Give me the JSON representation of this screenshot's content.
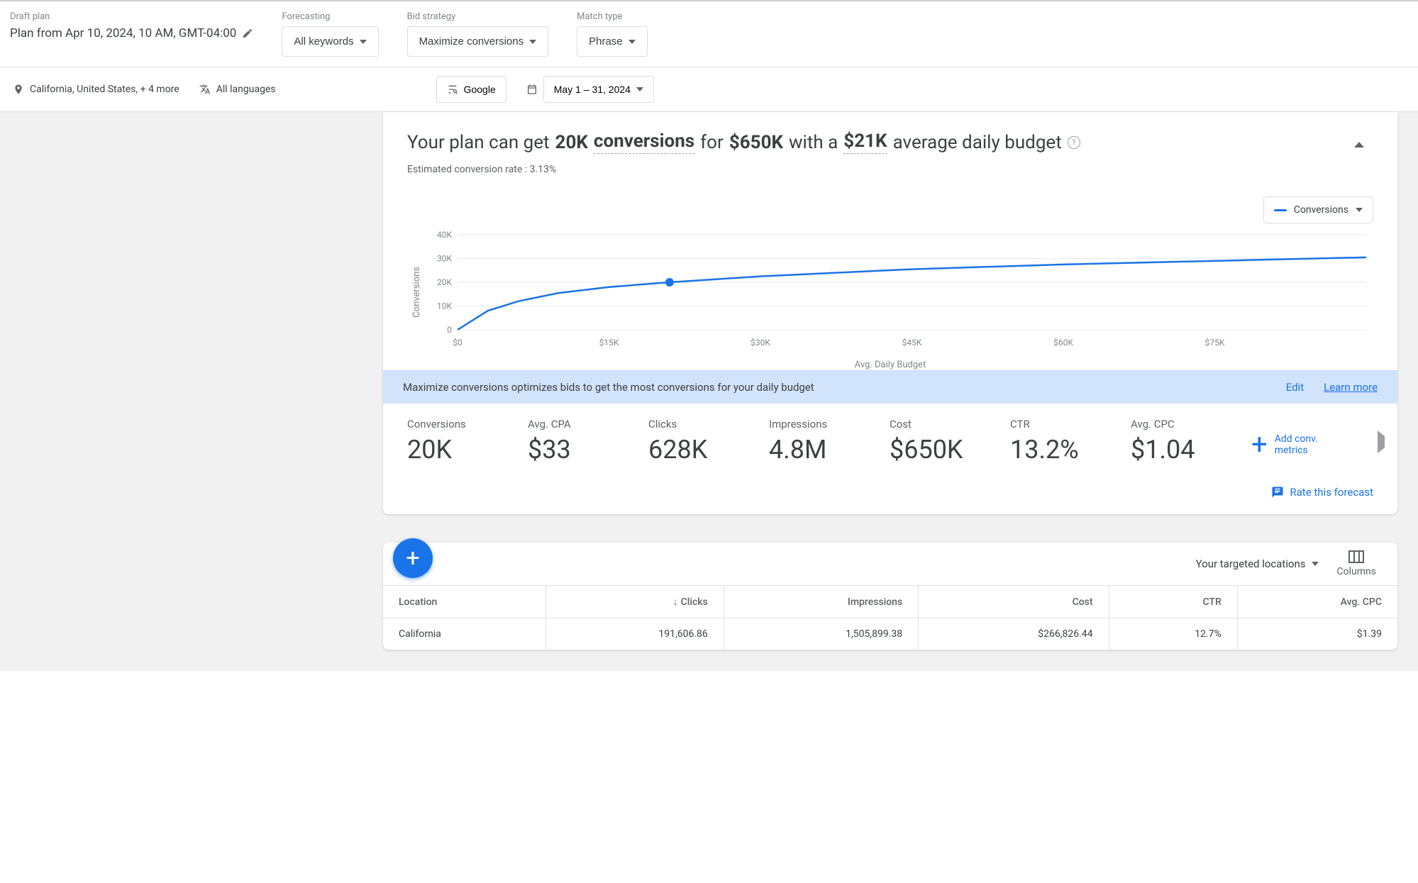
{
  "header": {
    "draft_label": "Draft plan",
    "title": "Plan from Apr 10, 2024, 10 AM, GMT-04:00",
    "forecasting_label": "Forecasting",
    "forecasting_value": "All keywords",
    "bid_label": "Bid strategy",
    "bid_value": "Maximize conversions",
    "match_label": "Match type",
    "match_value": "Phrase"
  },
  "subheader": {
    "location": "California, United States, + 4 more",
    "languages": "All languages",
    "network": "Google",
    "date_range": "May 1 – 31, 2024"
  },
  "summary": {
    "pre": "Your plan can get",
    "amount": "20K",
    "metric_word": "conversions",
    "for_word": "for",
    "cost": "$650K",
    "with_word": "with a",
    "daily": "$21K",
    "tail": "average daily budget",
    "estimate": "Estimated conversion rate : 3.13%",
    "chart_metric_selector": "Conversions"
  },
  "chart_data": {
    "type": "line",
    "title": "",
    "xlabel": "Avg. Daily Budget",
    "ylabel": "Conversions",
    "y_ticks": [
      "0",
      "10K",
      "20K",
      "30K",
      "40K"
    ],
    "x_ticks": [
      "$0",
      "$15K",
      "$30K",
      "$45K",
      "$60K",
      "$75K"
    ],
    "ylim": [
      0,
      40000
    ],
    "xlim": [
      0,
      90000
    ],
    "series": [
      {
        "name": "Conversions",
        "x": [
          0,
          3000,
          6000,
          10000,
          15000,
          21000,
          30000,
          45000,
          60000,
          75000,
          90000
        ],
        "y": [
          0,
          8000,
          12000,
          15500,
          18000,
          20000,
          22500,
          25500,
          27500,
          29000,
          30500
        ]
      }
    ],
    "marker": {
      "x": 21000,
      "y": 20000
    }
  },
  "banner": {
    "text": "Maximize conversions optimizes bids to get the most conversions for your daily budget",
    "edit": "Edit",
    "learn": "Learn more"
  },
  "metrics": [
    {
      "label": "Conversions",
      "value": "20K"
    },
    {
      "label": "Avg. CPA",
      "value": "$33"
    },
    {
      "label": "Clicks",
      "value": "628K"
    },
    {
      "label": "Impressions",
      "value": "4.8M"
    },
    {
      "label": "Cost",
      "value": "$650K"
    },
    {
      "label": "CTR",
      "value": "13.2%"
    },
    {
      "label": "Avg. CPC",
      "value": "$1.04"
    }
  ],
  "add_metric_line1": "Add conv.",
  "add_metric_line2": "metrics",
  "rate_text": "Rate this forecast",
  "locations": {
    "dropdown": "Your targeted locations",
    "columns_label": "Columns",
    "headers": [
      "Location",
      "Clicks",
      "Impressions",
      "Cost",
      "CTR",
      "Avg. CPC"
    ],
    "rows": [
      {
        "cells": [
          "California",
          "191,606.86",
          "1,505,899.38",
          "$266,826.44",
          "12.7%",
          "$1.39"
        ]
      }
    ]
  }
}
